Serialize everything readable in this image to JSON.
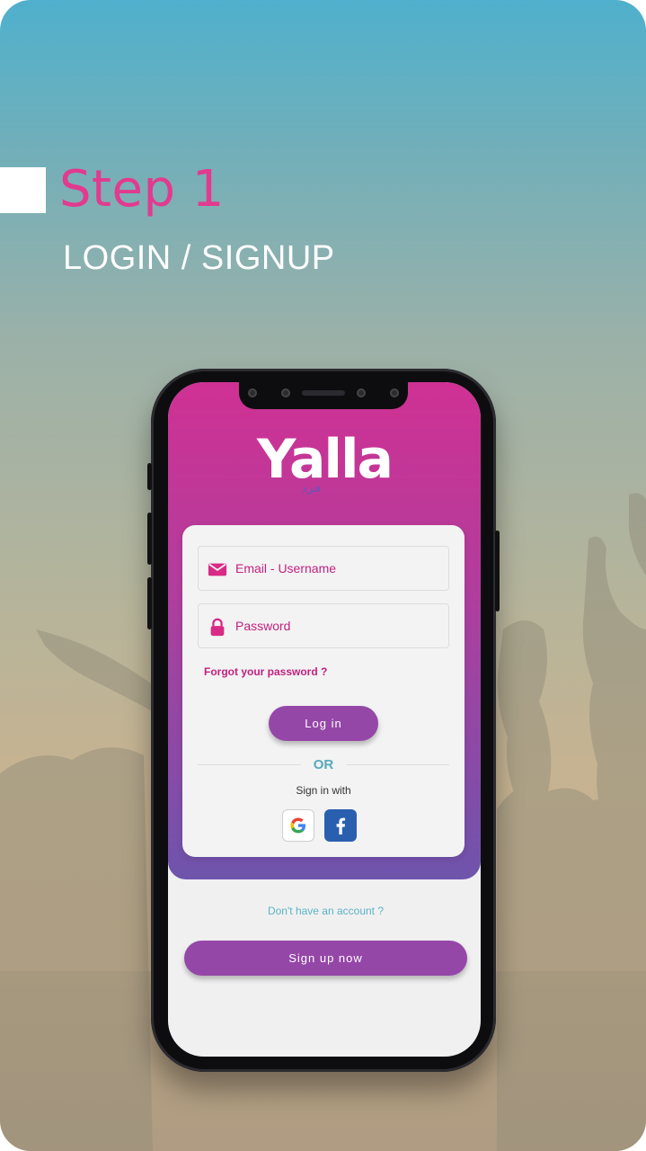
{
  "header": {
    "step_title": "Step 1",
    "step_subtitle": "LOGIN / SIGNUP"
  },
  "app": {
    "logo_text": "Yalla",
    "logo_tagline": "فرد"
  },
  "login_form": {
    "email_placeholder": "Email - Username",
    "password_placeholder": "Password",
    "forgot_label": "Forgot your password ?",
    "login_label": "Log in",
    "or_label": "OR",
    "sign_in_with_label": "Sign in with"
  },
  "social": {
    "google_icon": "google-icon",
    "facebook_icon": "facebook-icon"
  },
  "signup": {
    "prompt": "Don't have an account ?",
    "button_label": "Sign up now"
  },
  "colors": {
    "accent_pink": "#e23a8f",
    "button_purple": "#9547a8",
    "link_teal": "#5bb4c5",
    "facebook_blue": "#2a5fb0"
  }
}
